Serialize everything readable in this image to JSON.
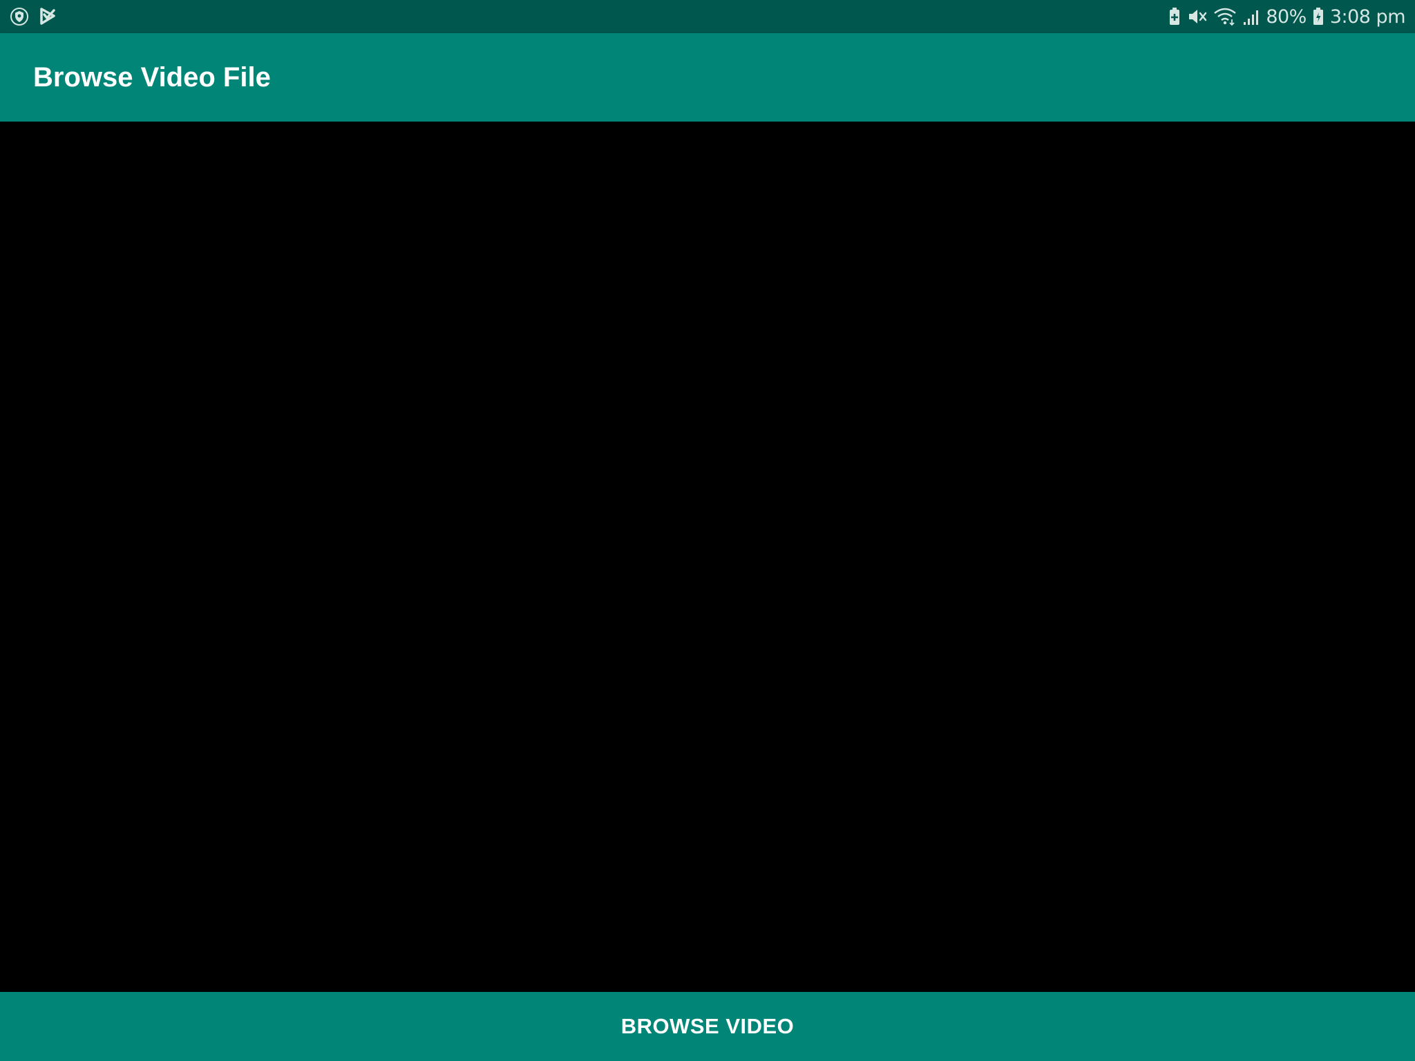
{
  "colors": {
    "status_bar": "#00574d",
    "primary": "#018577",
    "video_background": "#000000",
    "text_on_primary": "#ffffff"
  },
  "status_bar": {
    "left_icons": [
      "shield-notification-icon",
      "play-store-notification-icon"
    ],
    "right_icons": [
      "battery-saver-icon",
      "mute-icon",
      "wifi-icon",
      "cellular-signal-icon",
      "battery-icon"
    ],
    "battery_percent": "80%",
    "time": "3:08 pm"
  },
  "app_bar": {
    "title": "Browse Video File"
  },
  "video_view": {
    "state": "empty"
  },
  "browse_button": {
    "label": "BROWSE VIDEO"
  }
}
